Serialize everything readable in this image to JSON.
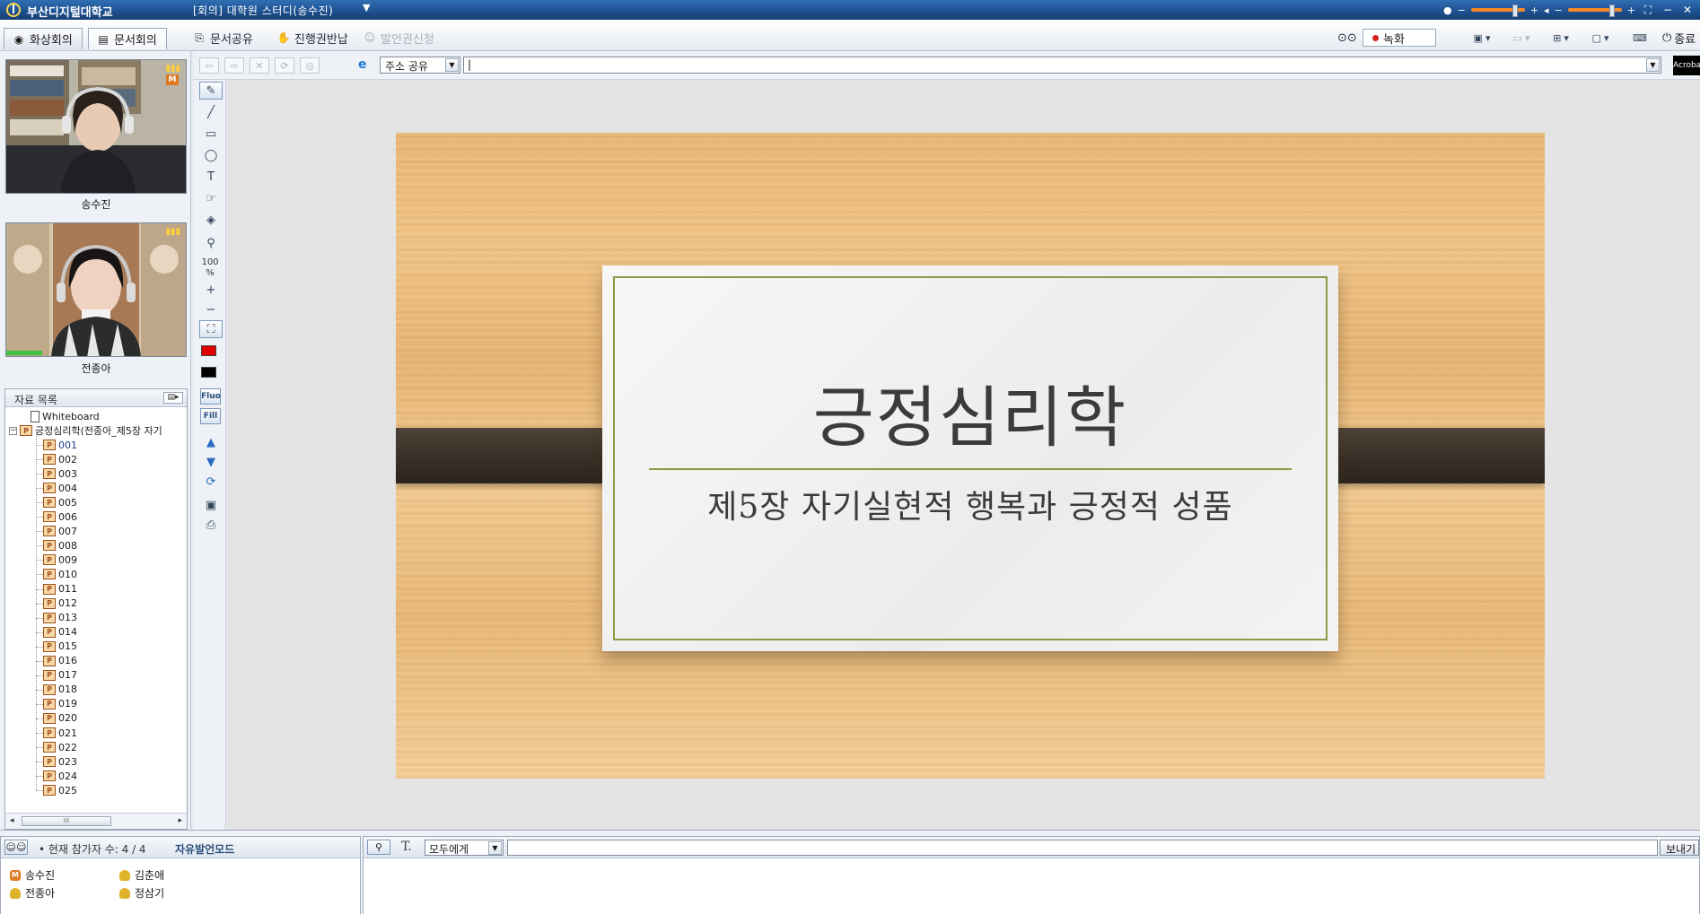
{
  "titlebar": {
    "school": "부산디지털대학교",
    "window_title": "[회의] 대학원 스터디(송수진)"
  },
  "tabs": [
    {
      "label": "화상회의",
      "icon": "camera-icon"
    },
    {
      "label": "문서회의",
      "icon": "document-icon"
    }
  ],
  "toolbar": {
    "share_doc": "문서공유",
    "return_control": "진행권반납",
    "request_speak": "발언권신청",
    "record": "녹화",
    "end": "종료"
  },
  "address": {
    "share_label": "주소 공유",
    "url": "",
    "acrobat": "Acrobat"
  },
  "videos": [
    {
      "name": "송수진",
      "badge": "M"
    },
    {
      "name": "전종아",
      "badge": ""
    }
  ],
  "files": {
    "header": "자료 목록",
    "whiteboard": "Whiteboard",
    "document": "긍정심리학(전종아_제5장 자기",
    "pages": [
      "001",
      "002",
      "003",
      "004",
      "005",
      "006",
      "007",
      "008",
      "009",
      "010",
      "011",
      "012",
      "013",
      "014",
      "015",
      "016",
      "017",
      "018",
      "019",
      "020",
      "021",
      "022",
      "023",
      "024",
      "025"
    ]
  },
  "tools": {
    "zoom_value": "100",
    "zoom_unit": "%",
    "fluo": "Fluo",
    "fill": "Fill",
    "pen_color": "#e00000",
    "fill_color": "#000000"
  },
  "slide": {
    "title": "긍정심리학",
    "subtitle": "제5장 자기실현적 행복과 긍정적 성품"
  },
  "participants": {
    "count_label": "• 현재 참가자 수: 4 / 4",
    "mode": "자유발언모드",
    "list": [
      {
        "name": "송수진",
        "role": "master"
      },
      {
        "name": "김춘애",
        "role": "member"
      },
      {
        "name": "전종아",
        "role": "member"
      },
      {
        "name": "정삼기",
        "role": "member"
      }
    ]
  },
  "chat": {
    "target": "모두에게",
    "message": "",
    "send": "보내기"
  }
}
